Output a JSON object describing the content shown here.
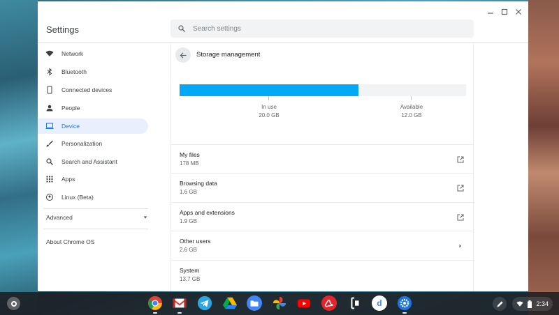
{
  "window": {
    "app_title": "Settings",
    "search_placeholder": "Search settings",
    "controls": [
      "minimize-icon",
      "maximize-icon",
      "close-icon"
    ]
  },
  "sidebar": {
    "items": [
      {
        "label": "Network",
        "icon": "wifi-icon"
      },
      {
        "label": "Bluetooth",
        "icon": "bluetooth-icon"
      },
      {
        "label": "Connected devices",
        "icon": "phone-icon"
      },
      {
        "label": "People",
        "icon": "person-icon"
      },
      {
        "label": "Device",
        "icon": "laptop-icon",
        "active": true
      },
      {
        "label": "Personalization",
        "icon": "brush-icon"
      },
      {
        "label": "Search and Assistant",
        "icon": "search-icon"
      },
      {
        "label": "Apps",
        "icon": "apps-grid-icon"
      },
      {
        "label": "Linux (Beta)",
        "icon": "linux-icon"
      }
    ],
    "advanced_label": "Advanced",
    "about_label": "About Chrome OS"
  },
  "main": {
    "title": "Storage management",
    "storage_bar": {
      "in_use_fraction": 0.625,
      "in_use_label": "In use",
      "in_use_value": "20.0 GB",
      "available_label": "Available",
      "available_value": "12.0 GB"
    },
    "rows": [
      {
        "title": "My files",
        "subtitle": "178 MB",
        "action": "open-external-icon"
      },
      {
        "title": "Browsing data",
        "subtitle": "1.6 GB",
        "action": "open-external-icon"
      },
      {
        "title": "Apps and extensions",
        "subtitle": "1.9 GB",
        "action": "open-external-icon"
      },
      {
        "title": "Other users",
        "subtitle": "2.6 GB",
        "action": "chevron-right-icon"
      },
      {
        "title": "System",
        "subtitle": "13.7 GB",
        "action": ""
      }
    ]
  },
  "shelf": {
    "apps": [
      "chrome-icon",
      "gmail-icon",
      "telegram-icon",
      "google-drive-icon",
      "files-icon",
      "google-photos-icon",
      "youtube-icon",
      "acrobat-icon",
      "docs-scanner-icon",
      "dictionary-icon",
      "settings-icon"
    ],
    "time": "2:34",
    "accent": "#03a9f4",
    "active_nav_bg": "#e8f0fe",
    "active_nav_text": "#1a73e8"
  }
}
